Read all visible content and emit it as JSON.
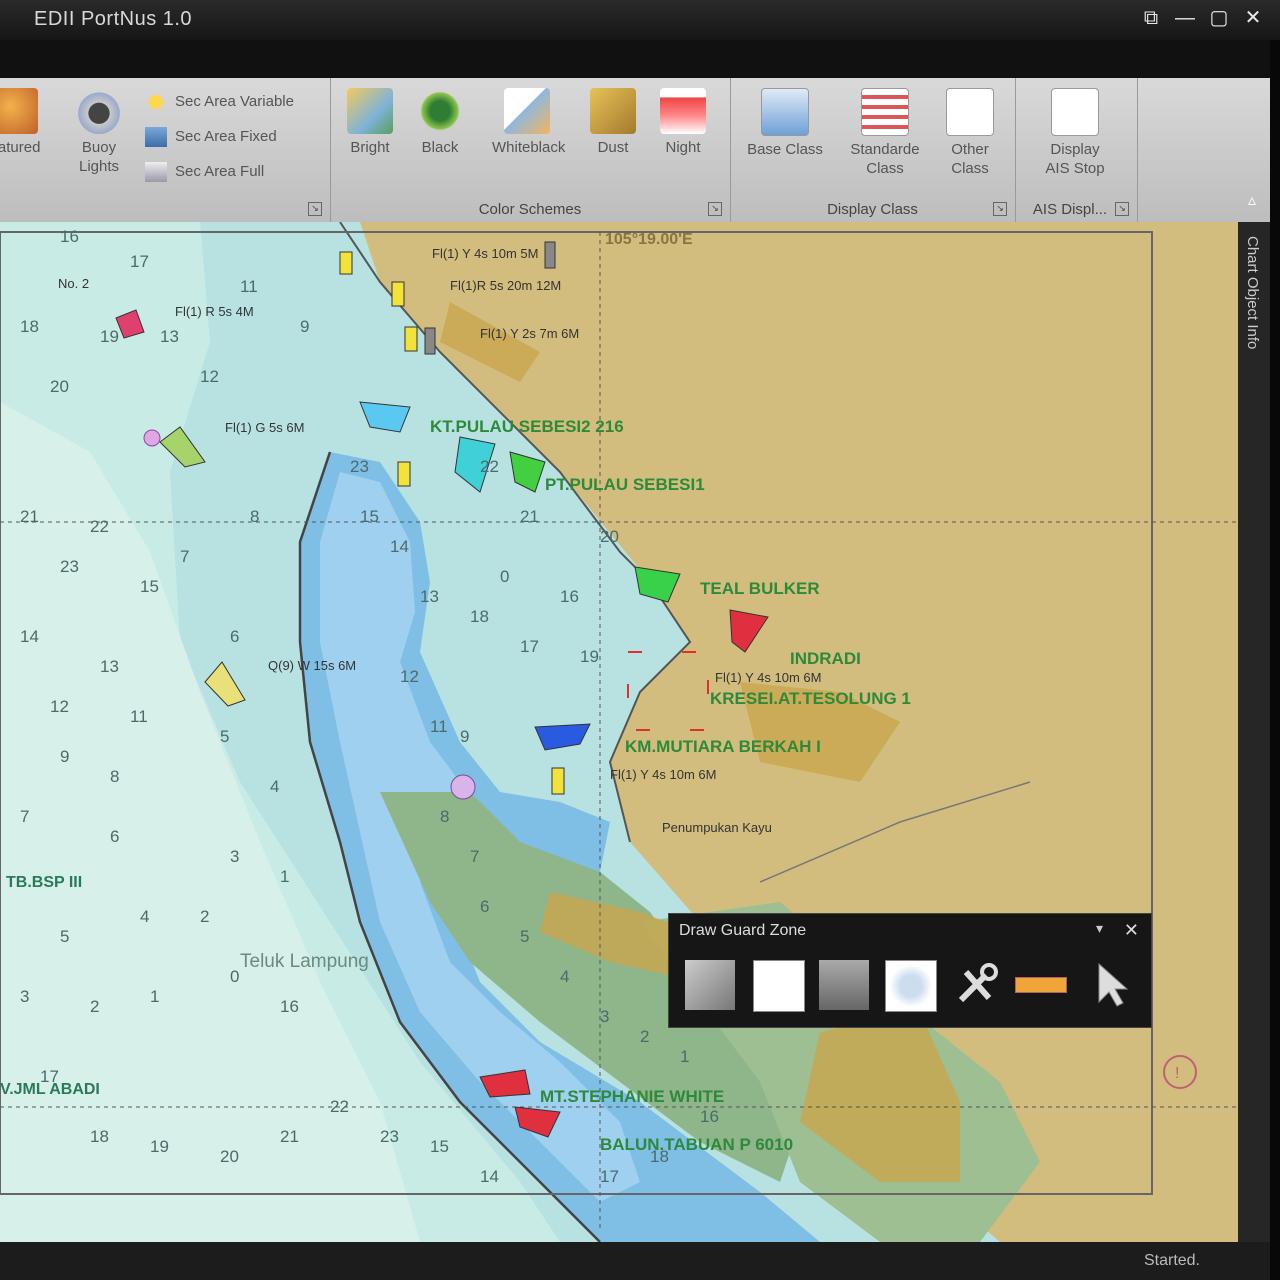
{
  "window": {
    "title": "EDII PortNus 1.0",
    "controls": [
      "⧉",
      "—",
      "▢",
      "✕"
    ]
  },
  "ribbon": {
    "left_group": {
      "featured_label": "eatured",
      "buoy_label": "Buoy Lights",
      "sec_area_variable": "Sec Area Variable",
      "sec_area_fixed": "Sec Area Fixed",
      "sec_area_full": "Sec Area Full"
    },
    "color_schemes": {
      "label": "Color Schemes",
      "buttons": [
        "Bright",
        "Black",
        "Whiteblack",
        "Dust",
        "Night"
      ]
    },
    "display_class": {
      "label": "Display Class",
      "buttons": [
        "Base Class",
        "Standarde Class",
        "Other Class"
      ]
    },
    "ais_display": {
      "label": "AIS Displ...",
      "button": "Display AIS Stop"
    },
    "collapse_glyph": "▵"
  },
  "side_panel": {
    "label": "Chart Object Info"
  },
  "status": {
    "text": "Started."
  },
  "guard_zone": {
    "title": "Draw Guard Zone",
    "pin": "▾",
    "close": "✕"
  },
  "map": {
    "longitude": "105°19.00'E",
    "vessels": [
      "KT.PULAU SEBESI2 216",
      "PT.PULAU SEBESI1",
      "TEAL BULKER",
      "INDRADI",
      "KRESEI.AT.TESOLUNG 1",
      "KM.MUTIARA BERKAH I",
      "TB.BSP III",
      "V.JML ABADI",
      "MT.STEPHANIE WHITE",
      "BALUN.TABUAN P 6010"
    ],
    "lights": [
      "Fl(1) Y 4s 10m 5M",
      "Fl(1)R 5s 20m 12M",
      "Fl(1) Y 2s 7m 6M",
      "Fl(1) R 5s 4M",
      "Fl(1) G 5s 6M",
      "Q(9) W 15s 6M",
      "Fl(1) Y 4s 10m 6M",
      "Fl(1) Y 4s 10m 6M"
    ],
    "places": [
      "No. 2",
      "Teluk Lampung",
      "Penumpukan Kayu"
    ],
    "soundings": [
      "16",
      "17",
      "18",
      "19",
      "20",
      "21",
      "22",
      "23",
      "15",
      "14",
      "13",
      "12",
      "11",
      "9",
      "8",
      "7",
      "6",
      "5",
      "4",
      "3",
      "2",
      "1",
      "0"
    ]
  }
}
